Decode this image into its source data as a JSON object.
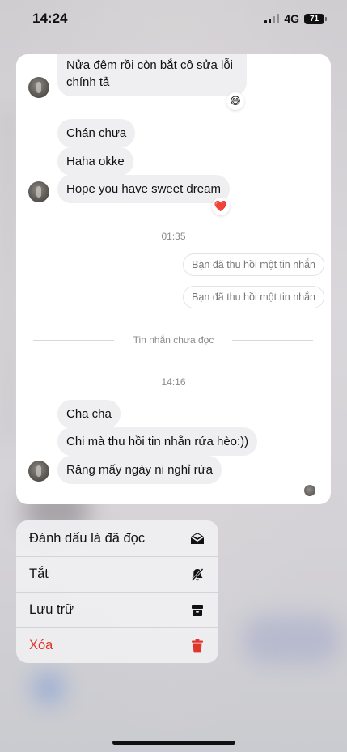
{
  "status_bar": {
    "time": "14:24",
    "network": "4G",
    "battery": "71"
  },
  "messages": {
    "m1": "Nửa đêm rồi còn bắt cô sửa lỗi chính tả",
    "m1_reaction": "😄",
    "m2": "Chán chưa",
    "m3": "Haha okke",
    "m4": "Hope you have sweet dream",
    "m4_reaction": "❤️",
    "time1": "01:35",
    "recalled1": "Bạn đã thu hồi một tin nhắn",
    "recalled2": "Bạn đã thu hồi một tin nhắn",
    "unread_divider": "Tin nhắn chưa đọc",
    "time2": "14:16",
    "m5": "Cha cha",
    "m6": "Chi mà thu hồi tin nhắn rứa hèo:))",
    "m7": "Răng mấy ngày ni nghỉ rứa"
  },
  "context_menu": {
    "items": [
      {
        "label": "Đánh dấu là đã đọc",
        "icon": "mark-read-icon"
      },
      {
        "label": "Tắt",
        "icon": "bell-slash-icon"
      },
      {
        "label": "Lưu trữ",
        "icon": "archive-icon"
      },
      {
        "label": "Xóa",
        "icon": "trash-icon"
      }
    ]
  },
  "colors": {
    "bubble": "#efeff1",
    "danger": "#e0352b",
    "menu_bg": "#eeeef0"
  }
}
